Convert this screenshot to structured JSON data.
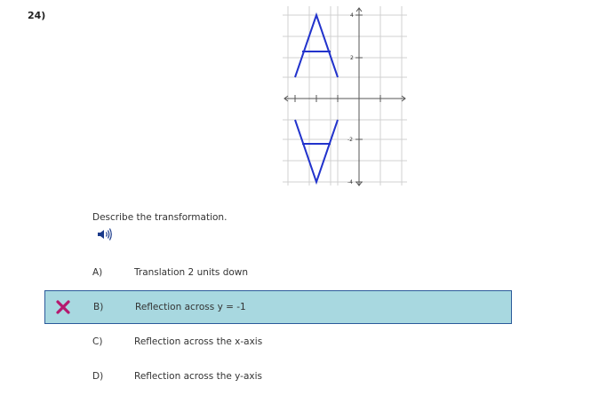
{
  "question": {
    "number": "24)",
    "prompt": "Describe the transformation."
  },
  "graph": {
    "y_tick_labels": [
      "4",
      "2",
      "-2",
      "-4"
    ],
    "figure_color": "#2233cc",
    "icon": "coordinate-plane-with-letter-A-and-its-reflection"
  },
  "audio": {
    "icon": "speaker-icon"
  },
  "choices": [
    {
      "letter": "A)",
      "text": "Translation 2 units down",
      "selected": false
    },
    {
      "letter": "B)",
      "text": "Reflection across y = -1",
      "selected": true,
      "result_icon": "incorrect-x-icon"
    },
    {
      "letter": "C)",
      "text": "Reflection across the x-axis",
      "selected": false
    },
    {
      "letter": "D)",
      "text": "Reflection across the y-axis",
      "selected": false
    }
  ],
  "colors": {
    "selected_bg": "#a8d8e0",
    "selected_border": "#2a5a9a",
    "incorrect_mark": "#b5196e"
  }
}
